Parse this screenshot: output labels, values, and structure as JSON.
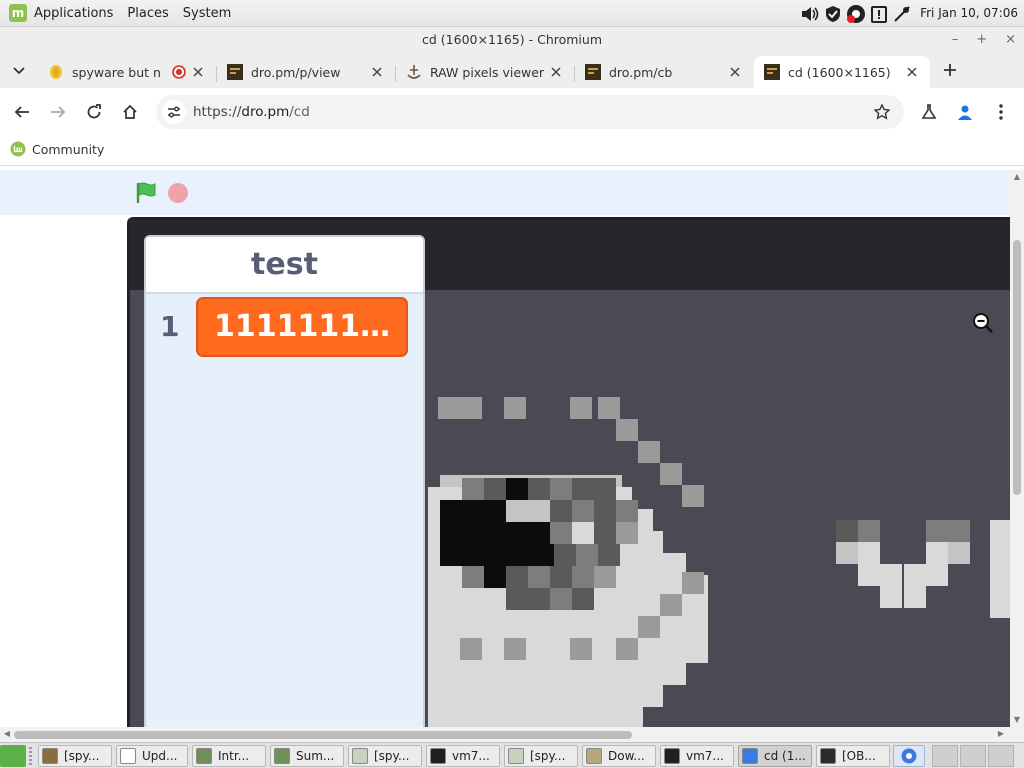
{
  "system_panel": {
    "menus": [
      "Applications",
      "Places",
      "System"
    ],
    "clock": "Fri Jan 10, 07:06"
  },
  "window": {
    "title": "cd (1600×1165) - Chromium"
  },
  "tabs": [
    {
      "title": "spyware but n",
      "favicon": "coin-icon",
      "recording": true
    },
    {
      "title": "dro.pm/p/view",
      "favicon": "dro-icon"
    },
    {
      "title": "RAW pixels viewer",
      "favicon": "ship-icon"
    },
    {
      "title": "dro.pm/cb",
      "favicon": "dro-icon"
    },
    {
      "title": "cd (1600×1165)",
      "favicon": "dro-icon",
      "active": true
    }
  ],
  "toolbar": {
    "url_scheme": "https://",
    "url_host": "dro.pm",
    "url_path": "/cd"
  },
  "bookmarks": [
    {
      "label": "Community",
      "icon": "mint-icon"
    }
  ],
  "stage": {
    "list_monitor": {
      "title": "test",
      "rows": [
        {
          "index": "1",
          "value": "111111111..."
        }
      ]
    }
  },
  "taskbar": {
    "tasks": [
      {
        "label": "[spy...",
        "icon": "file-icon"
      },
      {
        "label": "Upd...",
        "icon": "shield-icon"
      },
      {
        "label": "Intr...",
        "icon": "update-icon"
      },
      {
        "label": "Sum...",
        "icon": "update-icon"
      },
      {
        "label": "[spy...",
        "icon": "editor-icon"
      },
      {
        "label": "vm7...",
        "icon": "terminal-icon"
      },
      {
        "label": "[spy...",
        "icon": "editor-icon"
      },
      {
        "label": "Dow...",
        "icon": "folder-icon"
      },
      {
        "label": "vm7...",
        "icon": "terminal-icon"
      },
      {
        "label": "cd (1...",
        "icon": "chromium-icon",
        "active": true
      },
      {
        "label": "[OB...",
        "icon": "obs-icon"
      }
    ]
  },
  "colors": {
    "list_item": "#ff6a1f",
    "stage_bg": "#4a4954",
    "mint_green": "#8fc24c"
  }
}
